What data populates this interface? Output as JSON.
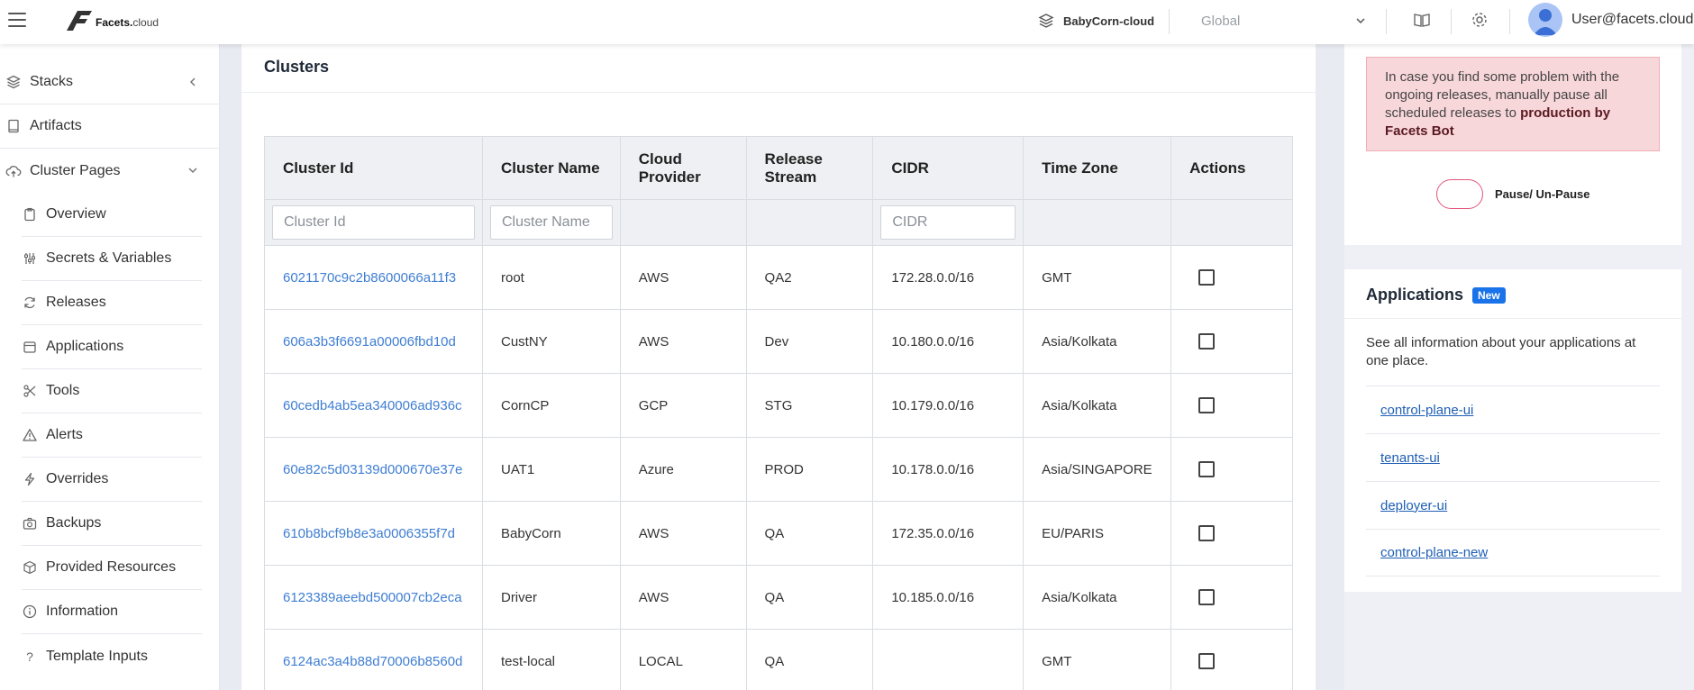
{
  "header": {
    "logo_text": "Facets.",
    "logo_suffix": "cloud",
    "stack_name": "BabyCorn-cloud",
    "region": "Global",
    "user": "User@facets.cloud"
  },
  "sidebar": {
    "stacks": "Stacks",
    "artifacts": "Artifacts",
    "cluster_pages": "Cluster Pages",
    "sub": [
      "Overview",
      "Secrets & Variables",
      "Releases",
      "Applications",
      "Tools",
      "Alerts",
      "Overrides",
      "Backups",
      "Provided Resources",
      "Information",
      "Template Inputs"
    ]
  },
  "main": {
    "title": "Clusters",
    "columns": [
      "Cluster Id",
      "Cluster Name",
      "Cloud Provider",
      "Release Stream",
      "CIDR",
      "Time Zone",
      "Actions"
    ],
    "filters": {
      "cluster_id": "Cluster Id",
      "cluster_name": "Cluster Name",
      "cidr": "CIDR"
    },
    "rows": [
      {
        "id": "6021170c9c2b8600066a11f3",
        "name": "root",
        "cloud": "AWS",
        "stream": "QA2",
        "cidr": "172.28.0.0/16",
        "tz": "GMT"
      },
      {
        "id": "606a3b3f6691a00006fbd10d",
        "name": "CustNY",
        "cloud": "AWS",
        "stream": "Dev",
        "cidr": "10.180.0.0/16",
        "tz": "Asia/Kolkata"
      },
      {
        "id": "60cedb4ab5ea340006ad936c",
        "name": "CornCP",
        "cloud": "GCP",
        "stream": "STG",
        "cidr": "10.179.0.0/16",
        "tz": "Asia/Kolkata"
      },
      {
        "id": "60e82c5d03139d000670e37e",
        "name": "UAT1",
        "cloud": "Azure",
        "stream": "PROD",
        "cidr": "10.178.0.0/16",
        "tz": "Asia/SINGAPORE"
      },
      {
        "id": "610b8bcf9b8e3a0006355f7d",
        "name": "BabyCorn",
        "cloud": "AWS",
        "stream": "QA",
        "cidr": "172.35.0.0/16",
        "tz": "EU/PARIS"
      },
      {
        "id": "6123389aeebd500007cb2eca",
        "name": "Driver",
        "cloud": "AWS",
        "stream": "QA",
        "cidr": "10.185.0.0/16",
        "tz": "Asia/Kolkata"
      },
      {
        "id": "6124ac3a4b88d70006b8560d",
        "name": "test-local",
        "cloud": "LOCAL",
        "stream": "QA",
        "cidr": "",
        "tz": "GMT"
      }
    ]
  },
  "release_panel": {
    "alert_text": "In case you find some problem with the ongoing releases, manually pause all scheduled releases to",
    "alert_bold": "production by Facets Bot",
    "toggle_label": "Pause/ Un-Pause",
    "toggle_on": false,
    "accent": "#e2557a"
  },
  "applications_panel": {
    "title": "Applications",
    "badge": "New",
    "description": "See all information about your applications at one place.",
    "links": [
      "control-plane-ui",
      "tenants-ui",
      "deployer-ui",
      "control-plane-new"
    ]
  }
}
